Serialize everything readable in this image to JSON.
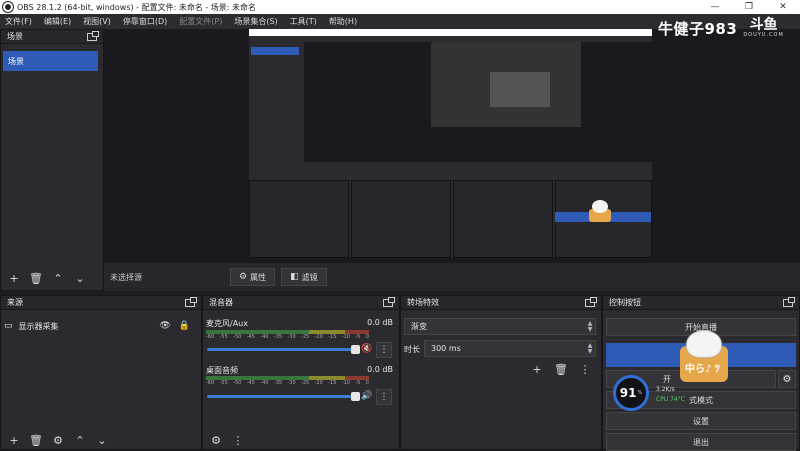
{
  "window": {
    "title": "OBS 28.1.2 (64-bit, windows) - 配置文件: 未命名 - 场景: 未命名"
  },
  "menu": {
    "items": [
      "文件(F)",
      "编辑(E)",
      "视图(V)",
      "停靠窗口(D)",
      "配置文件(P)",
      "场景集合(S)",
      "工具(T)",
      "帮助(H)"
    ]
  },
  "watermark": {
    "text": "牛健子983",
    "logo": "斗鱼",
    "logo_sub": "DOUYU.COM"
  },
  "scenes": {
    "title": "场景",
    "items": [
      "场景"
    ]
  },
  "preview": {
    "no_source": "未选择源",
    "properties_label": "属性",
    "filters_label": "滤镜"
  },
  "sources": {
    "title": "来源",
    "items": [
      {
        "name": "显示器采集"
      }
    ]
  },
  "mixer": {
    "title": "混音器",
    "scale": [
      "-60",
      "-55",
      "-50",
      "-45",
      "-40",
      "-35",
      "-30",
      "-25",
      "-20",
      "-15",
      "-10",
      "-5",
      "0"
    ],
    "channels": [
      {
        "name": "麦克风/Aux",
        "db": "0.0 dB",
        "level": 0.94,
        "muted": true
      },
      {
        "name": "桌面音频",
        "db": "0.0 dB",
        "level": 0.94,
        "muted": false
      }
    ]
  },
  "transitions": {
    "title": "转场特效",
    "selected": "渐变",
    "duration_label": "时长",
    "duration_value": "300 ms"
  },
  "controls": {
    "title": "控制按钮",
    "start_stream": "开始直播",
    "start_record_partial": "开",
    "studio_mode_partial": "式模式",
    "settings": "设置",
    "exit": "退出"
  },
  "overlay": {
    "cat_text": "中ら♪ ﾂ",
    "gauge_value": "91",
    "gauge_unit": "%",
    "speed": "3.2K/s",
    "cpu": "CPU 74°C"
  }
}
